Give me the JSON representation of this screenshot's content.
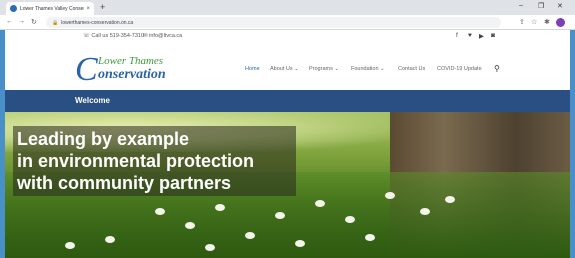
{
  "browser": {
    "tab_title": "Lower Thames Valley Conservati",
    "tab_close": "×",
    "new_tab": "+",
    "url": "lowerthames-conservation.on.ca",
    "minimize": "–",
    "maximize": "❐",
    "close": "✕"
  },
  "topbar": {
    "phone": "☏ Call us 519-354-7310",
    "email": "✉ info@ltvca.ca",
    "social_icons": [
      "facebook-icon",
      "twitter-icon",
      "youtube-icon",
      "instagram-icon"
    ]
  },
  "logo": {
    "initial": "C",
    "line1": "Lower Thames",
    "line2": "onservation"
  },
  "nav": {
    "items": [
      {
        "label": "Home"
      },
      {
        "label": "About Us ⌄"
      },
      {
        "label": "Programs ⌄"
      },
      {
        "label": "Foundation ⌄"
      },
      {
        "label": "Contact Us"
      },
      {
        "label": "COVID-19 Update"
      }
    ],
    "search_icon": "search-icon"
  },
  "welcome": {
    "label": "Welcome"
  },
  "hero": {
    "lines": [
      "Leading by example",
      "in environmental protection",
      "with community partners"
    ]
  },
  "colors": {
    "brand_blue": "#2a63a8",
    "brand_green": "#3a9a3a",
    "welcome_bar": "#2a4f82"
  }
}
